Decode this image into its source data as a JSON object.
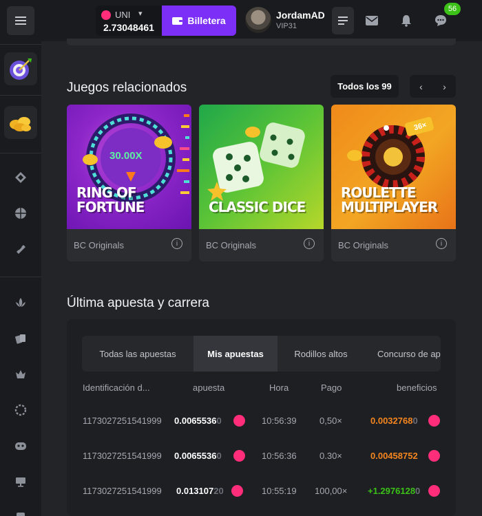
{
  "topbar": {
    "currency": "UNI",
    "balance": "2.73048461",
    "wallet_label": "Billetera",
    "username": "JordamAD",
    "vip": "VIP31",
    "notifications_count": "56"
  },
  "related": {
    "title": "Juegos relacionados",
    "see_all": "Todos los 99",
    "games": [
      {
        "art_title_line1": "RING OF",
        "art_title_line2": "FORTUNE",
        "multiplier": "30.00X",
        "provider": "BC Originals"
      },
      {
        "art_title_line1": "CLASSIC DICE",
        "art_title_line2": "",
        "provider": "BC Originals"
      },
      {
        "art_title_line1": "ROULETTE",
        "art_title_line2": "MULTIPLAYER",
        "badge": "36×",
        "provider": "BC Originals"
      }
    ]
  },
  "bets": {
    "title": "Última apuesta y carrera",
    "tabs": [
      "Todas las apuestas",
      "Mis apuestas",
      "Rodillos altos",
      "Concurso de apuesta"
    ],
    "columns": [
      "Identificación d...",
      "apuesta",
      "Hora",
      "Pago",
      "beneficios"
    ],
    "rows": [
      {
        "id": "1173027251541999",
        "bet": "0.0065536",
        "bet_tail": "0",
        "time": "10:56:39",
        "payout": "0,50×",
        "profit": "0.0032768",
        "profit_tail": "0",
        "profit_color": "#f5861f"
      },
      {
        "id": "1173027251541999",
        "bet": "0.0065536",
        "bet_tail": "0",
        "time": "10:56:36",
        "payout": "0.30×",
        "profit": "0.00458752",
        "profit_tail": "",
        "profit_color": "#f5861f"
      },
      {
        "id": "1173027251541999",
        "bet": "0.013107",
        "bet_tail": "20",
        "time": "10:55:19",
        "payout": "100,00×",
        "profit": "+1.2976128",
        "profit_tail": "0",
        "profit_color": "#3bc117"
      }
    ]
  },
  "colors": {
    "accent": "#7b2ff7",
    "coin": "#ff2d7a",
    "positive": "#3bc117",
    "negative": "#f5861f"
  }
}
